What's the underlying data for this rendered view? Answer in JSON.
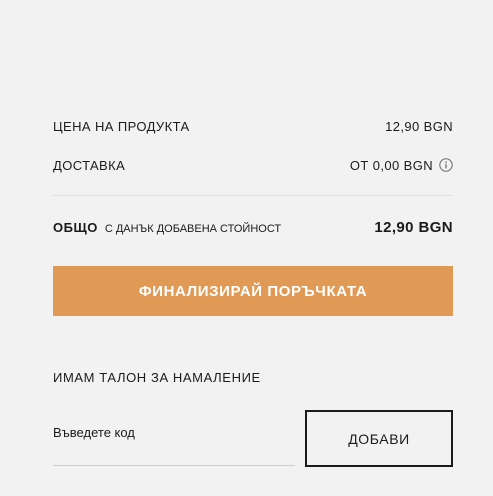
{
  "summary": {
    "price_label": "ЦЕНА НА ПРОДУКТА",
    "price_value": "12,90 BGN",
    "delivery_label": "ДОСТАВКА",
    "delivery_value": "ОТ 0,00 BGN",
    "delivery_info_icon": "info-icon",
    "total_label": "ОБЩО",
    "total_note": "С ДАНЪК ДОБАВЕНА СТОЙНОСТ",
    "total_value": "12,90 BGN"
  },
  "checkout": {
    "button_label": "ФИНАЛИЗИРАЙ ПОРЪЧКАТА",
    "button_color": "#e19a55"
  },
  "coupon": {
    "heading": "ИМАМ ТАЛОН ЗА НАМАЛЕНИЕ",
    "input_placeholder": "Въведете код",
    "add_button_label": "ДОБАВИ"
  }
}
